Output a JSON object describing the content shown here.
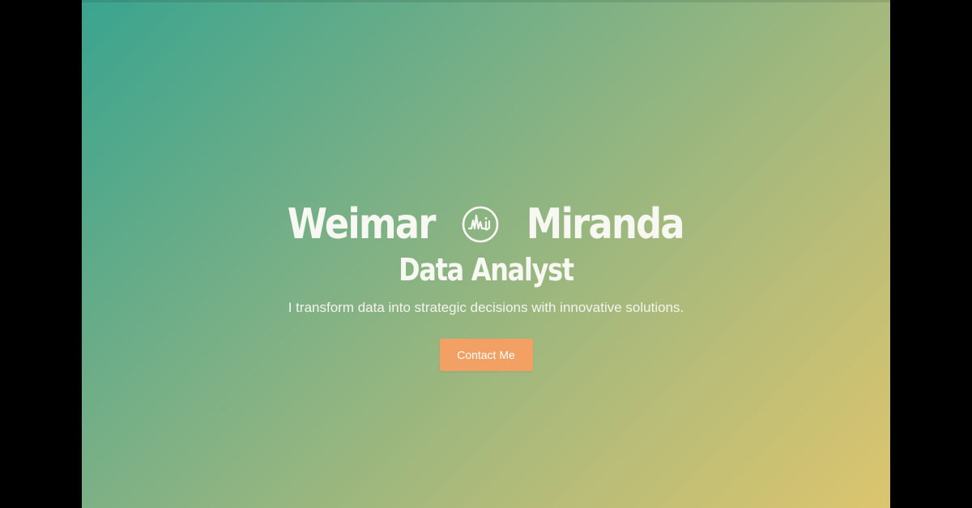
{
  "hero": {
    "first_name": "Weimar",
    "last_name": "Miranda",
    "logo_icon": "wm-signature-logo-icon",
    "role": "Data Analyst",
    "tagline": "I transform data into strategic decisions with innovative solutions.",
    "cta_label": "Contact Me"
  },
  "colors": {
    "gradient_start": "#3aa48f",
    "gradient_end": "#dcc56e",
    "button": "#f2a064",
    "text": "#f8f8f3",
    "letterbox": "#000000"
  }
}
